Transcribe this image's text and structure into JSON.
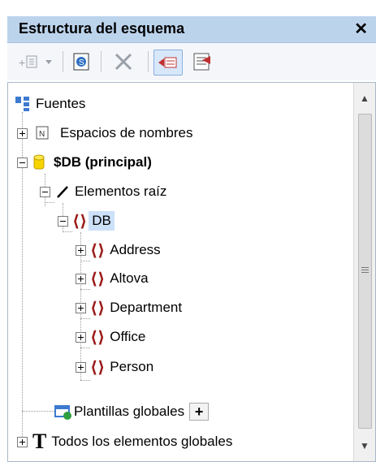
{
  "panel": {
    "title": "Estructura del esquema",
    "close_symbol": "✕"
  },
  "toolbar": {
    "items": [
      {
        "name": "add-element-dropdown",
        "icon": "add-element-icon"
      },
      {
        "name": "schema-info",
        "icon": "schema-info-icon"
      },
      {
        "name": "delete",
        "icon": "delete-icon"
      },
      {
        "name": "show-global-templates-toggle",
        "icon": "global-templates-toggle-icon"
      },
      {
        "name": "select-elements",
        "icon": "list-select-icon"
      }
    ]
  },
  "tree": {
    "sources": "Fuentes",
    "namespaces": "Espacios de nombres",
    "db_main": "$DB (principal)",
    "root_elements": "Elementos raíz",
    "db": "DB",
    "children": [
      "Address",
      "Altova",
      "Department",
      "Office",
      "Person"
    ],
    "global_templates": "Plantillas globales",
    "add_button": "+",
    "all_globals": "Todos los elementos globales",
    "namespace_badge": "N",
    "brace_glyph": "⟨⟩",
    "T_glyph": "T"
  }
}
